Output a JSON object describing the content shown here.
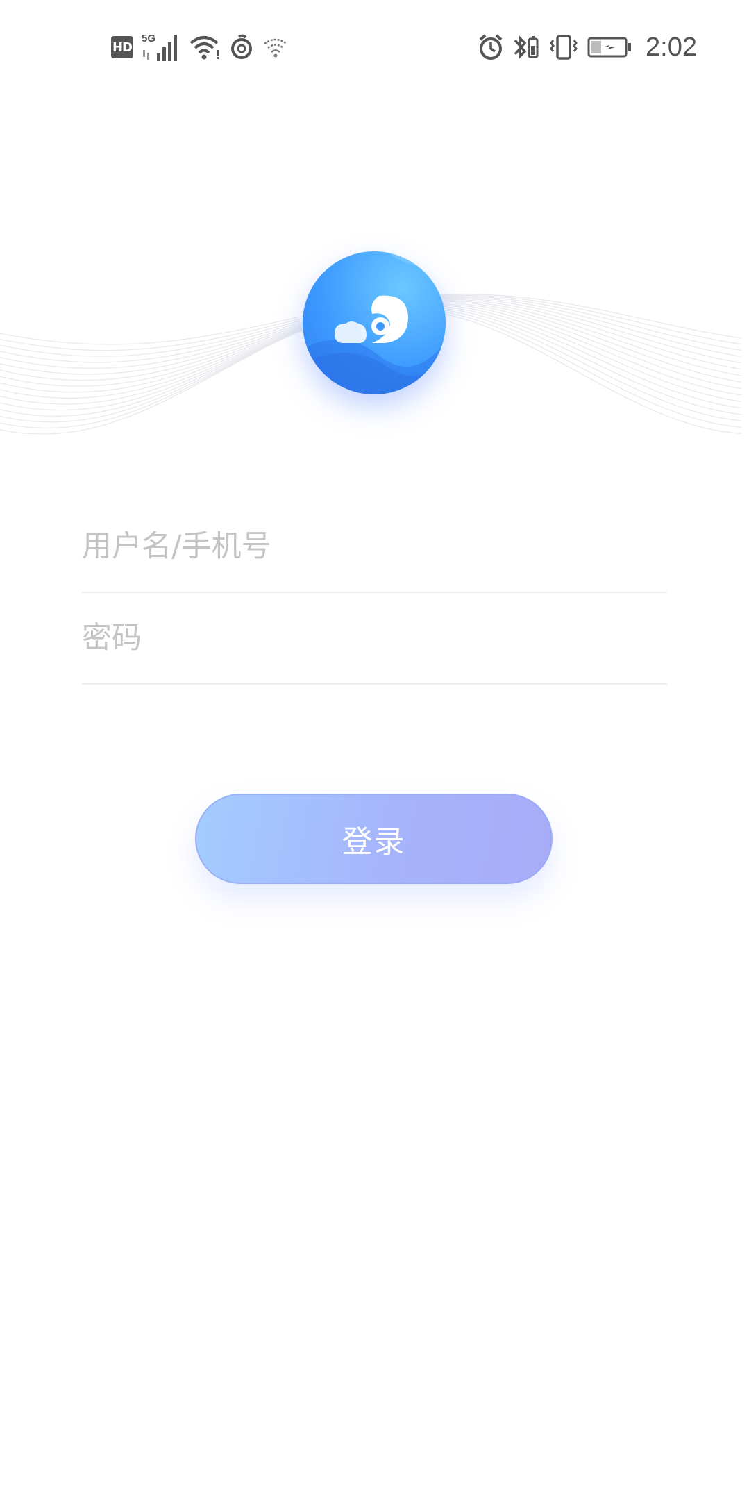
{
  "status_bar": {
    "hd_label": "HD",
    "network_label": "5G",
    "time": "2:02",
    "icons": [
      "hd-icon",
      "signal-5g-icon",
      "wifi-icon",
      "netease-music-icon",
      "wifi-hotspot-icon",
      "alarm-icon",
      "bluetooth-icon",
      "vibrate-icon",
      "battery-charging-icon"
    ]
  },
  "logo": {
    "icon": "app-logo-icon"
  },
  "login_form": {
    "username": {
      "value": "",
      "placeholder": "用户名/手机号"
    },
    "password": {
      "value": "",
      "placeholder": "密码"
    },
    "submit_label": "登录"
  },
  "colors": {
    "logo_blue": "#3d9bff",
    "button_gradient_start": "#a4cdff",
    "button_gradient_end": "#a8acf8",
    "placeholder": "#c4c4c4",
    "divider": "#eeeeee"
  }
}
